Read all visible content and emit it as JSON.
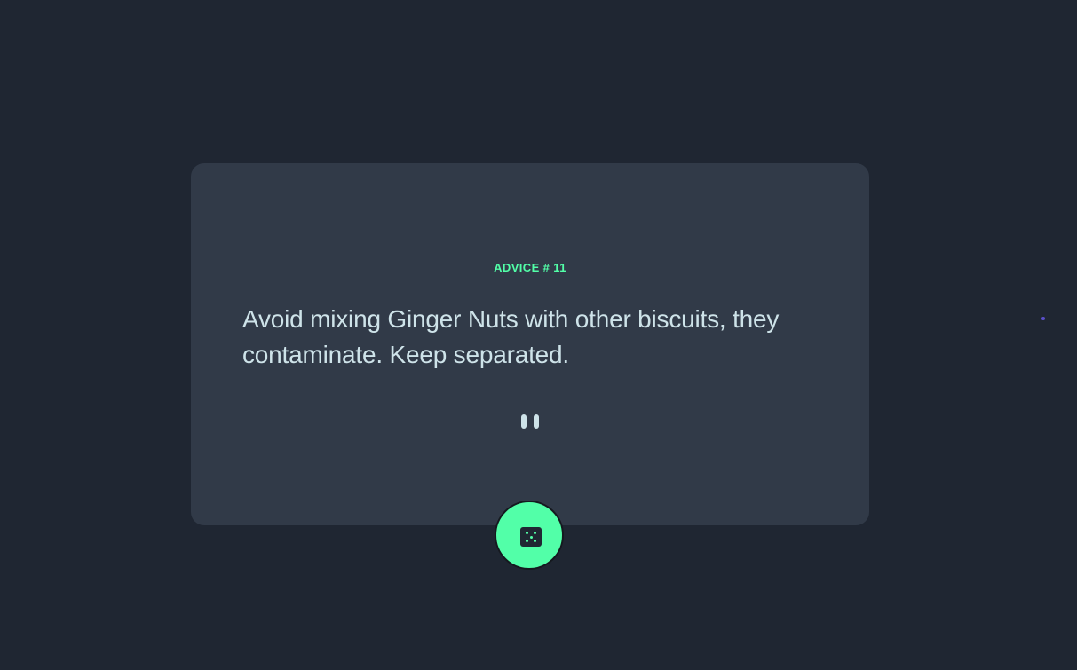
{
  "advice": {
    "label": "ADVICE # 11",
    "text": "Avoid mixing Ginger Nuts with other biscuits, they contaminate. Keep separated."
  },
  "icons": {
    "divider": "pause-icon",
    "button": "dice-icon"
  },
  "colors": {
    "background": "#1f2632",
    "card": "#313a48",
    "accent": "#52ffa8",
    "text": "#cee3e9",
    "divider": "#4f5d74"
  }
}
